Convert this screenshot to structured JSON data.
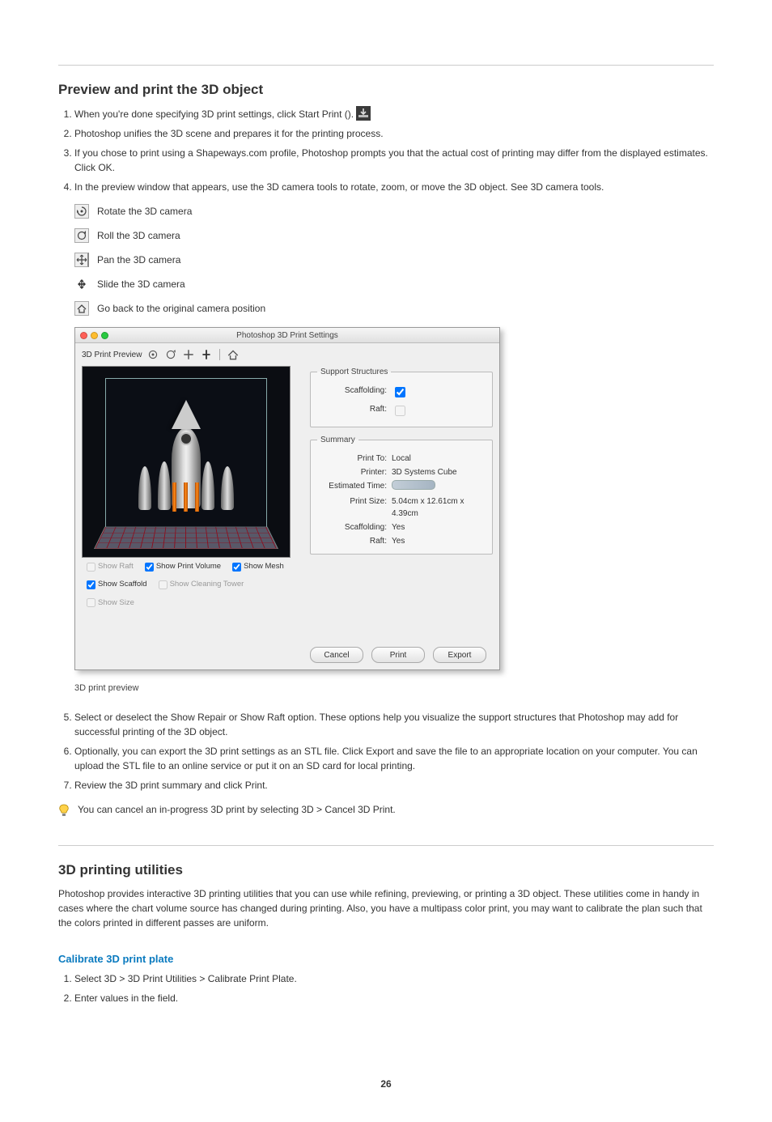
{
  "section1": {
    "heading": "Preview and print the 3D object",
    "steps": [
      "When you're done specifying 3D print settings, click Start Print ().",
      "Photoshop unifies the 3D scene and prepares it for the printing process.",
      "If you chose to print using a Shapeways.com profile, Photoshop prompts you that the actual cost of printing may differ from the displayed estimates. Click OK.",
      "In the preview window that appears, use the 3D camera tools to rotate, zoom, or move the 3D object. See 3D camera tools."
    ],
    "tools": [
      "Rotate the 3D camera",
      "Roll the 3D camera",
      "Pan the 3D camera",
      "Slide the 3D camera",
      "Go back to the original camera position"
    ],
    "start_print_icon_name": "start-print-icon"
  },
  "screenshot": {
    "window_title": "Photoshop 3D Print Settings",
    "toolbar_label": "3D Print Preview",
    "checkboxes": {
      "show_raft": "Show Raft",
      "show_print_volume": "Show Print Volume",
      "show_mesh": "Show Mesh",
      "show_scaffold": "Show Scaffold",
      "show_cleaning_tower": "Show Cleaning Tower",
      "show_size": "Show Size"
    },
    "support": {
      "legend": "Support Structures",
      "scaffolding_label": "Scaffolding:",
      "raft_label": "Raft:"
    },
    "summary": {
      "legend": "Summary",
      "rows": {
        "print_to": {
          "k": "Print To:",
          "v": "Local"
        },
        "printer": {
          "k": "Printer:",
          "v": "3D Systems Cube"
        },
        "estimated": {
          "k": "Estimated Time:",
          "v": ""
        },
        "print_size": {
          "k": "Print Size:",
          "v": "5.04cm x 12.61cm x 4.39cm"
        },
        "scaffolding": {
          "k": "Scaffolding:",
          "v": "Yes"
        },
        "raft": {
          "k": "Raft:",
          "v": "Yes"
        }
      }
    },
    "buttons": {
      "cancel": "Cancel",
      "print": "Print",
      "export": "Export"
    }
  },
  "caption": "3D print preview",
  "after_steps": [
    "Select or deselect the Show Repair or Show Raft option. These options help you visualize the support structures that Photoshop may add for successful printing of the 3D object.",
    "Optionally, you can export the 3D print settings as an STL file. Click Export and save the file to an appropriate location on your computer. You can upload the STL file to an online service or put it on an SD card for local printing.",
    "Review the 3D print summary and click Print."
  ],
  "tip_text": "You can cancel an in-progress 3D print by selecting 3D > Cancel 3D Print.",
  "utilities": {
    "heading": "3D printing utilities",
    "intro": "Photoshop provides interactive 3D printing utilities that you can use while refining, previewing, or printing a 3D object. These utilities come in handy in cases where the chart volume source has changed during printing. Also, you have a multipass color print, you may want to calibrate the plan such that the colors printed in different passes are uniform.",
    "sub": "Calibrate 3D print plate",
    "sub_steps": [
      "Select 3D > 3D Print Utilities > Calibrate Print Plate.",
      "Enter values in the field."
    ]
  },
  "page_number": "26"
}
